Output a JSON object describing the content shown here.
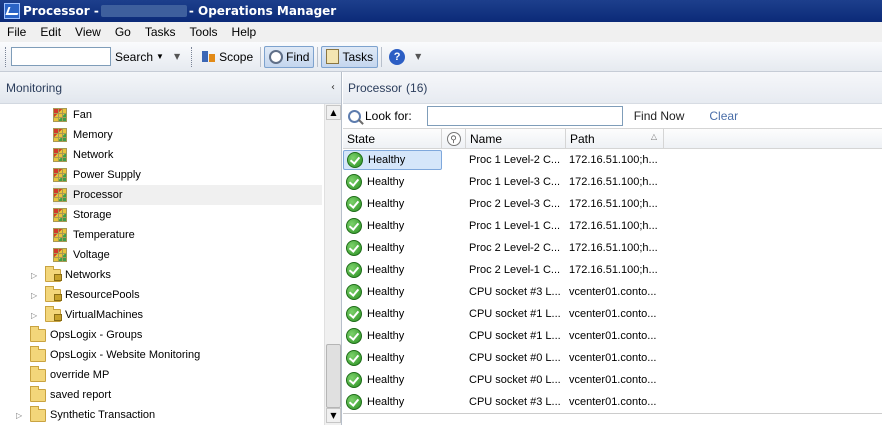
{
  "window": {
    "title_prefix": "Processor -",
    "title_suffix": "- Operations Manager"
  },
  "menu": [
    "File",
    "Edit",
    "View",
    "Go",
    "Tasks",
    "Tools",
    "Help"
  ],
  "toolbar": {
    "search_value": "",
    "search_label": "Search",
    "scope_label": "Scope",
    "find_label": "Find",
    "tasks_label": "Tasks",
    "help_glyph": "?"
  },
  "left_panel": {
    "title": "Monitoring",
    "collapse_glyph": "‹",
    "items": [
      {
        "label": "Fan",
        "icon": "state-view-icon"
      },
      {
        "label": "Memory",
        "icon": "state-view-icon"
      },
      {
        "label": "Network",
        "icon": "state-view-icon"
      },
      {
        "label": "Power Supply",
        "icon": "state-view-icon"
      },
      {
        "label": "Processor",
        "icon": "state-view-icon",
        "selected": true
      },
      {
        "label": "Storage",
        "icon": "state-view-icon"
      },
      {
        "label": "Temperature",
        "icon": "state-view-icon"
      },
      {
        "label": "Voltage",
        "icon": "state-view-icon"
      },
      {
        "label": "Networks",
        "icon": "locked-folder-icon"
      },
      {
        "label": "ResourcePools",
        "icon": "locked-folder-icon"
      },
      {
        "label": "VirtualMachines",
        "icon": "locked-folder-icon"
      },
      {
        "label": "OpsLogix - Groups",
        "icon": "folder-icon"
      },
      {
        "label": "OpsLogix - Website Monitoring",
        "icon": "folder-icon"
      },
      {
        "label": "override MP",
        "icon": "folder-icon"
      },
      {
        "label": "saved report",
        "icon": "folder-icon"
      },
      {
        "label": "Synthetic Transaction",
        "icon": "folder-icon"
      }
    ]
  },
  "right_panel": {
    "title": "Processor",
    "count": "(16)",
    "look_for_label": "Look for:",
    "look_for_value": "",
    "find_now_label": "Find Now",
    "clear_label": "Clear",
    "columns": {
      "state": "State",
      "name": "Name",
      "path": "Path"
    },
    "rows": [
      {
        "state": "Healthy",
        "name": "Proc 1 Level-2 C...",
        "path": "172.16.51.100;h..."
      },
      {
        "state": "Healthy",
        "name": "Proc 1 Level-3 C...",
        "path": "172.16.51.100;h..."
      },
      {
        "state": "Healthy",
        "name": "Proc 2 Level-3 C...",
        "path": "172.16.51.100;h..."
      },
      {
        "state": "Healthy",
        "name": "Proc 1 Level-1 C...",
        "path": "172.16.51.100;h..."
      },
      {
        "state": "Healthy",
        "name": "Proc 2 Level-2 C...",
        "path": "172.16.51.100;h..."
      },
      {
        "state": "Healthy",
        "name": "Proc 2 Level-1 C...",
        "path": "172.16.51.100;h..."
      },
      {
        "state": "Healthy",
        "name": "CPU socket #3 L...",
        "path": "vcenter01.conto..."
      },
      {
        "state": "Healthy",
        "name": "CPU socket #1 L...",
        "path": "vcenter01.conto..."
      },
      {
        "state": "Healthy",
        "name": "CPU socket #1 L...",
        "path": "vcenter01.conto..."
      },
      {
        "state": "Healthy",
        "name": "CPU socket #0 L...",
        "path": "vcenter01.conto..."
      },
      {
        "state": "Healthy",
        "name": "CPU socket #0 L...",
        "path": "vcenter01.conto..."
      },
      {
        "state": "Healthy",
        "name": "CPU socket #3 L...",
        "path": "vcenter01.conto..."
      }
    ]
  }
}
